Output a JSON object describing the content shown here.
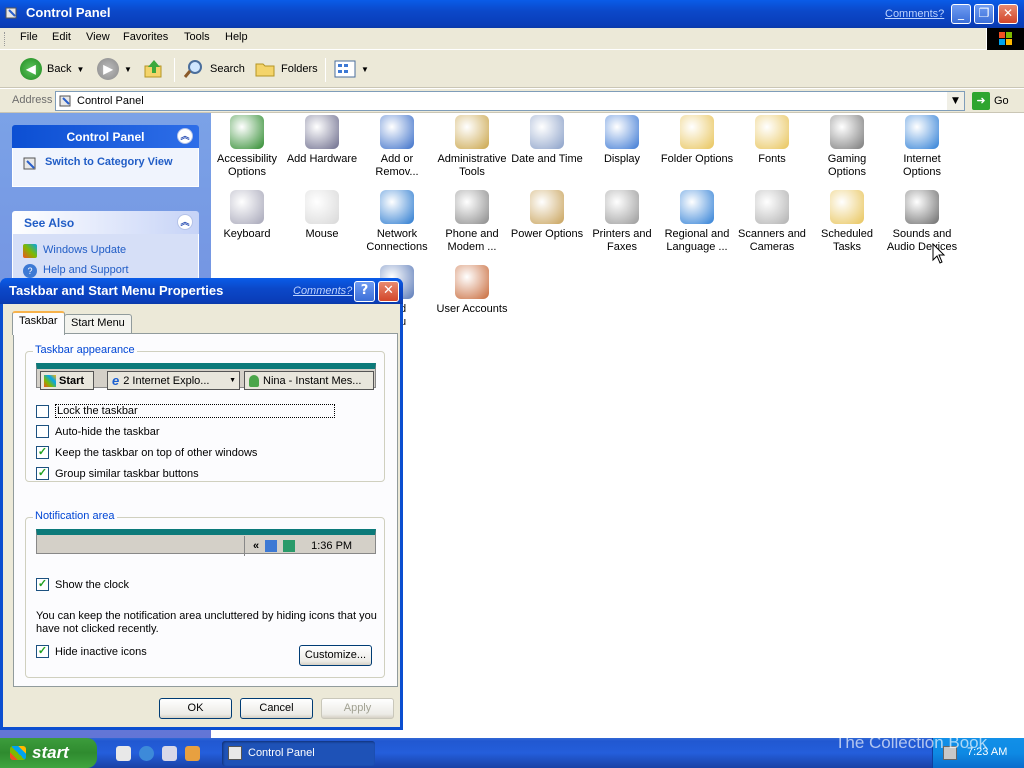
{
  "window": {
    "title": "Control Panel",
    "comments": "Comments?"
  },
  "menu": [
    "File",
    "Edit",
    "View",
    "Favorites",
    "Tools",
    "Help"
  ],
  "toolbar": {
    "back": "Back",
    "search": "Search",
    "folders": "Folders"
  },
  "address": {
    "label": "Address",
    "value": "Control Panel",
    "go": "Go"
  },
  "sidebar": {
    "panel1_title": "Control Panel",
    "switch_view": "Switch to Category View",
    "panel2_title": "See Also",
    "links": [
      "Windows Update",
      "Help and Support"
    ]
  },
  "items": [
    {
      "label": "Accessibility Options",
      "color": "#2e8b2e"
    },
    {
      "label": "Add Hardware",
      "color": "#6c6c8c"
    },
    {
      "label": "Add or Remov...",
      "color": "#3b6fc9"
    },
    {
      "label": "Administrative Tools",
      "color": "#caa54a"
    },
    {
      "label": "Date and Time",
      "color": "#8aa0c8"
    },
    {
      "label": "Display",
      "color": "#3d79d4"
    },
    {
      "label": "Folder Options",
      "color": "#e8c45a"
    },
    {
      "label": "Fonts",
      "color": "#e8c45a"
    },
    {
      "label": "Gaming Options",
      "color": "#7a7a7a"
    },
    {
      "label": "Internet Options",
      "color": "#2f7fd6"
    },
    {
      "label": "Keyboard",
      "color": "#a6a6b8"
    },
    {
      "label": "Mouse",
      "color": "#d8d8d8"
    },
    {
      "label": "Network Connections",
      "color": "#2a7ad0"
    },
    {
      "label": "Phone and Modem ...",
      "color": "#8a8a8a"
    },
    {
      "label": "Power Options",
      "color": "#c8a25a"
    },
    {
      "label": "Printers and Faxes",
      "color": "#9a9a9a"
    },
    {
      "label": "Regional and Language ...",
      "color": "#2f7fd6"
    },
    {
      "label": "Scanners and Cameras",
      "color": "#b0b0b0"
    },
    {
      "label": "Scheduled Tasks",
      "color": "#e8c45a"
    },
    {
      "label": "Sounds and Audio Devices",
      "color": "#6c6c6c"
    },
    {
      "label": "and\nenu",
      "color": "#5a7ab8"
    },
    {
      "label": "User Accounts",
      "color": "#c86a3a"
    }
  ],
  "dialog": {
    "title": "Taskbar and Start Menu Properties",
    "comments": "Comments?",
    "tabs": [
      "Taskbar",
      "Start Menu"
    ],
    "appearance_legend": "Taskbar appearance",
    "preview": {
      "start": "Start",
      "ie": "2 Internet Explo...",
      "messenger": "Nina - Instant Mes..."
    },
    "options": [
      {
        "label": "Lock the taskbar",
        "checked": false
      },
      {
        "label": "Auto-hide the taskbar",
        "checked": false
      },
      {
        "label": "Keep the taskbar on top of other windows",
        "checked": true
      },
      {
        "label": "Group similar taskbar buttons",
        "checked": true
      }
    ],
    "notify_legend": "Notification area",
    "notify_chevron": "«",
    "notify_time": "1:36 PM",
    "show_clock": "Show the clock",
    "hint": "You can keep the notification area uncluttered by hiding icons that you have not clicked recently.",
    "hide_inactive": "Hide inactive icons",
    "customize": "Customize...",
    "ok": "OK",
    "cancel": "Cancel",
    "apply": "Apply"
  },
  "taskbar": {
    "start": "start",
    "item": "Control Panel",
    "clock": "7:23 AM"
  },
  "watermark": "The Collection Book"
}
